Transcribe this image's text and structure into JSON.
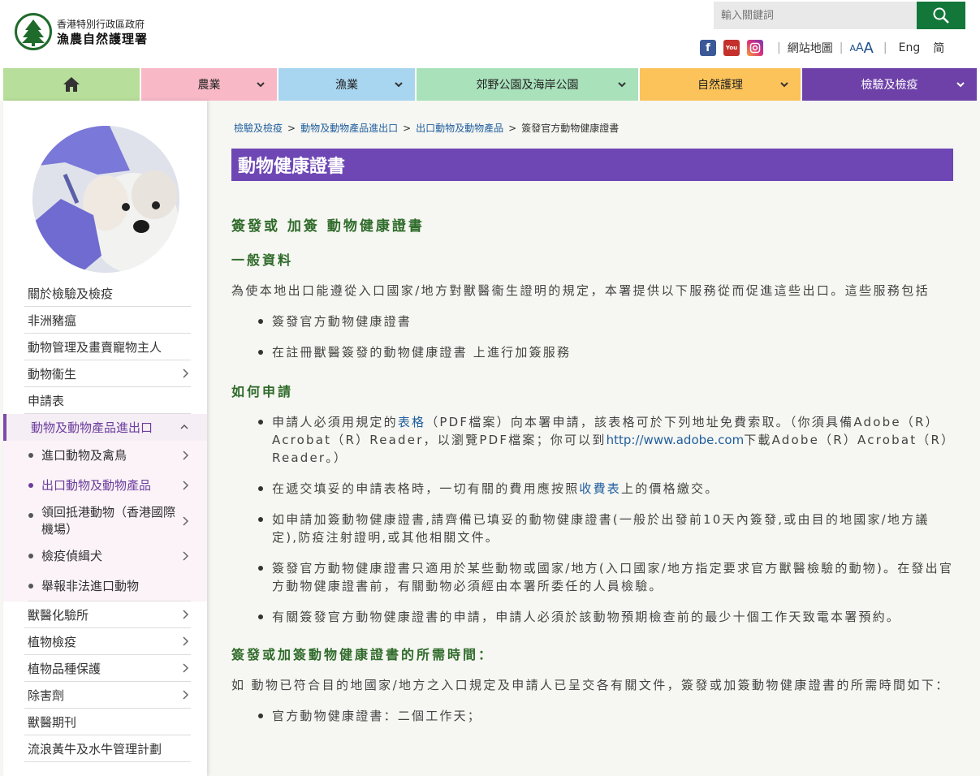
{
  "header": {
    "logo_line1": "香港特別行政區政府",
    "logo_line2": "漁農自然護理署",
    "search_placeholder": "輸入關鍵詞",
    "sitemap": "網站地圖",
    "font_a1": "A",
    "font_a2": "A",
    "font_a3": "A",
    "lang_eng": "Eng",
    "lang_simp": "简"
  },
  "nav": {
    "agri": "農業",
    "fish": "漁業",
    "park": "郊野公園及海岸公園",
    "cons": "自然護理",
    "insp": "檢驗及檢疫"
  },
  "breadcrumb": {
    "b1": "檢驗及檢疫",
    "b2": "動物及動物產品進出口",
    "b3": "出口動物及動物產品",
    "b4": "簽發官方動物健康證書",
    "sep": ">"
  },
  "page_title": "動物健康證書",
  "sidebar": {
    "items_top": [
      "關於檢驗及檢疫",
      "非洲豬瘟",
      "動物管理及畫賣寵物主人",
      "動物衞生",
      "申請表"
    ],
    "active": "動物及動物產品進出口",
    "sub": [
      "進口動物及禽鳥",
      "出口動物及動物產品",
      "領回抵港動物（香港國際機場）",
      "檢疫偵緝犬",
      "舉報非法進口動物"
    ],
    "items_bottom": [
      "獸醫化驗所",
      "植物檢疫",
      "植物品種保護",
      "除害劑",
      "獸醫期刊",
      "流浪黃牛及水牛管理計劃"
    ]
  },
  "content": {
    "h1": "簽發或 加簽 動物健康證書",
    "h2": "一般資料",
    "p1": "為使本地出口能遵從入口國家/地方對獸醫衞生證明的規定，本署提供以下服務從而促進這些出口。這些服務包括",
    "b1": "簽發官方動物健康證書",
    "b2": "在註冊獸醫簽發的動物健康證書 上進行加簽服務",
    "h3": "如何申請",
    "b3_pre": "申請人必須用規定的",
    "b3_link": "表格",
    "b3_mid": "（PDF檔案）向本署申請，該表格可於下列地址免費索取。（你須具備Adobe（R）Acrobat（R）Reader，以瀏覽PDF檔案；你可以到",
    "b3_url": "http://www.adobe.com",
    "b3_post": "下載Adobe（R）Acrobat（R）Reader。）",
    "b4_pre": "在遞交填妥的申請表格時，一切有關的費用應按照",
    "b4_link": "收費表",
    "b4_post": "上的價格繳交。",
    "b5": "如申請加簽動物健康證書,請齊備已填妥的動物健康證書(一般於出發前10天內簽發,或由目的地國家/地方議定),防疫注射證明,或其他相關文件。",
    "b6": "簽發官方動物健康證書只適用於某些動物或國家/地方(入口國家/地方指定要求官方獸醫檢驗的動物)。在發出官方動物健康證書前，有關動物必須經由本署所委任的人員檢驗。",
    "b7": "有關簽發官方動物健康證書的申請，申請人必須於該動物預期檢查前的最少十個工作天致電本署預約。",
    "h4": "簽發或加簽動物健康證書的所需時間：",
    "p2": "如 動物已符合目的地國家/地方之入口規定及申請人已呈交各有關文件，簽發或加簽動物健康證書的所需時間如下：",
    "b8": "官方動物健康證書：二個工作天；"
  },
  "colors": {
    "brand_green": "#13773a",
    "title_purple": "#6e47b5",
    "heading_green": "#2f6b2a",
    "link_blue": "#1f5e9e"
  }
}
